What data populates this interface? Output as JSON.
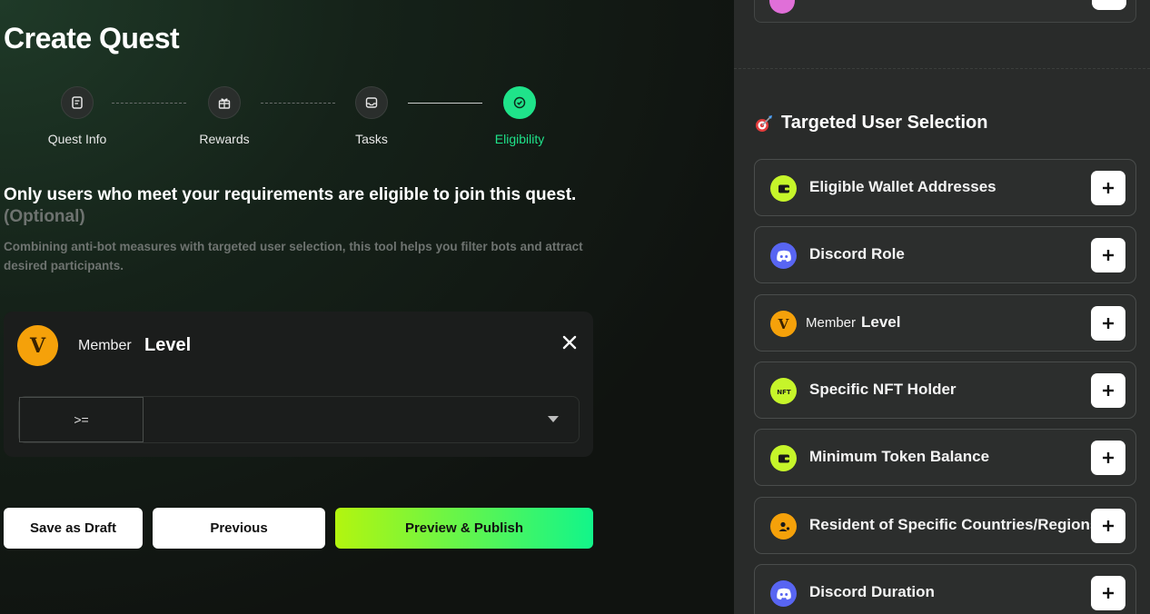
{
  "page": {
    "title": "Create Quest"
  },
  "stepper": {
    "steps": [
      {
        "label": "Quest Info",
        "icon": "document-icon",
        "active": false
      },
      {
        "label": "Rewards",
        "icon": "gift-icon",
        "active": false
      },
      {
        "label": "Tasks",
        "icon": "inbox-icon",
        "active": false
      },
      {
        "label": "Eligibility",
        "icon": "check-circle-icon",
        "active": true
      }
    ]
  },
  "eligibility": {
    "heading": "Only users who meet your requirements are eligible to join this quest.",
    "optional": "(Optional)",
    "description": "Combining anti-bot measures with targeted user selection, this tool helps you filter bots and attract desired participants."
  },
  "condition": {
    "avatar_letter": "V",
    "member_label": "Member",
    "level_label": "Level",
    "operator": ">=",
    "value": ""
  },
  "actions": {
    "save_draft": "Save as Draft",
    "previous": "Previous",
    "preview_publish": "Preview & Publish"
  },
  "sidebar": {
    "section_title": "Targeted User Selection",
    "options": [
      {
        "label": "Eligible Wallet Addresses",
        "icon": "wallet-icon",
        "color": "#c6f52a"
      },
      {
        "label": "Discord Role",
        "icon": "discord-icon",
        "color": "#5865f2"
      },
      {
        "prefix": "Member",
        "label": "Level",
        "icon": "v-logo-icon",
        "color": "#f5a10a"
      },
      {
        "label": "Specific NFT Holder",
        "icon": "nft-icon",
        "color": "#c6f52a"
      },
      {
        "label": "Minimum Token Balance",
        "icon": "wallet-icon",
        "color": "#c6f52a"
      },
      {
        "label": "Resident of Specific Countries/Regions",
        "icon": "person-location-icon",
        "color": "#f5a10a"
      },
      {
        "label": "Discord Duration",
        "icon": "discord-icon",
        "color": "#5865f2"
      }
    ]
  },
  "colors": {
    "accent": "#1fe38a",
    "lime": "#b3f50f",
    "panel": "#292b2a"
  }
}
